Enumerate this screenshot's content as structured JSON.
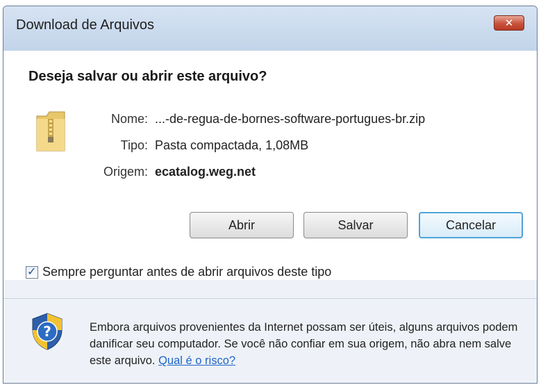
{
  "window": {
    "title": "Download de Arquivos",
    "close_icon": "close-icon"
  },
  "dialog": {
    "question": "Deseja salvar ou abrir este arquivo?",
    "file_icon": "zip-folder-icon",
    "fields": {
      "name_label": "Nome:",
      "name_value": "...-de-regua-de-bornes-software-portugues-br.zip",
      "type_label": "Tipo:",
      "type_value": "Pasta compactada, 1,08MB",
      "origin_label": "Origem:",
      "origin_value": "ecatalog.weg.net"
    },
    "buttons": {
      "open": "Abrir",
      "save": "Salvar",
      "cancel": "Cancelar"
    },
    "always_ask": {
      "checked": true,
      "label": "Sempre perguntar antes de abrir arquivos deste tipo"
    }
  },
  "warning": {
    "icon": "security-shield-icon",
    "text": "Embora arquivos provenientes da Internet possam ser úteis, alguns arquivos podem danificar seu computador. Se você não confiar em sua origem, não abra nem salve este arquivo.",
    "link_text": "Qual é o risco?"
  },
  "colors": {
    "title_bar": "#c2d4ea",
    "close_button": "#c8523b",
    "focused_button_border": "#4fa3d9",
    "link": "#1f64c8"
  }
}
